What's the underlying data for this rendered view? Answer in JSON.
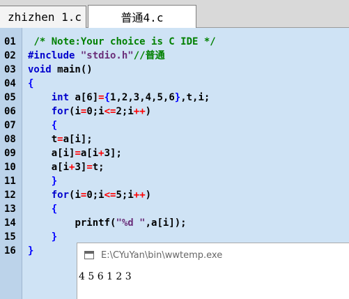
{
  "tabs": [
    {
      "label": "zhizhen 1.c",
      "active": false
    },
    {
      "label": "普通4.c",
      "active": true
    }
  ],
  "line_numbers": [
    "01",
    "02",
    "03",
    "04",
    "05",
    "06",
    "07",
    "08",
    "09",
    "10",
    "11",
    "12",
    "13",
    "14",
    "15",
    "16"
  ],
  "code": {
    "l01_comment": "/* Note:Your choice is C IDE */",
    "l02_directive": "#include ",
    "l02_string": "\"stdio.h\"",
    "l02_comment": "//普通",
    "l03_type": "void",
    "l03_rest": " main()",
    "l04_brace": "{",
    "l05_type": "int",
    "l05_a": " a[6]",
    "l05_eq": "=",
    "l05_brace_open": "{",
    "l05_vals": "1,2,3,4,5,6",
    "l05_brace_close": "}",
    "l05_rest": ",t,i;",
    "l06_kw": "for",
    "l06_a": "(i",
    "l06_eq": "=",
    "l06_b": "0;i",
    "l06_le": "<=",
    "l06_c": "2;i",
    "l06_inc": "++",
    "l06_d": ")",
    "l07_brace": "{",
    "l08_a": "t",
    "l08_eq": "=",
    "l08_b": "a[i];",
    "l09_a": "a[i]",
    "l09_eq": "=",
    "l09_b": "a[i",
    "l09_plus": "+",
    "l09_c": "3];",
    "l10_a": "a[i",
    "l10_plus": "+",
    "l10_b": "3]",
    "l10_eq": "=",
    "l10_c": "t;",
    "l11_brace": "}",
    "l12_kw": "for",
    "l12_a": "(i",
    "l12_eq": "=",
    "l12_b": "0;i",
    "l12_le": "<=",
    "l12_c": "5;i",
    "l12_inc": "++",
    "l12_d": ")",
    "l13_brace": "{",
    "l14_a": "printf(",
    "l14_str": "\"%d \"",
    "l14_b": ",a[i]);",
    "l15_brace": "}",
    "l16_brace": "}"
  },
  "console": {
    "title": "E:\\CYuYan\\bin\\wwtemp.exe",
    "output": "4 5 6 1 2 3"
  }
}
